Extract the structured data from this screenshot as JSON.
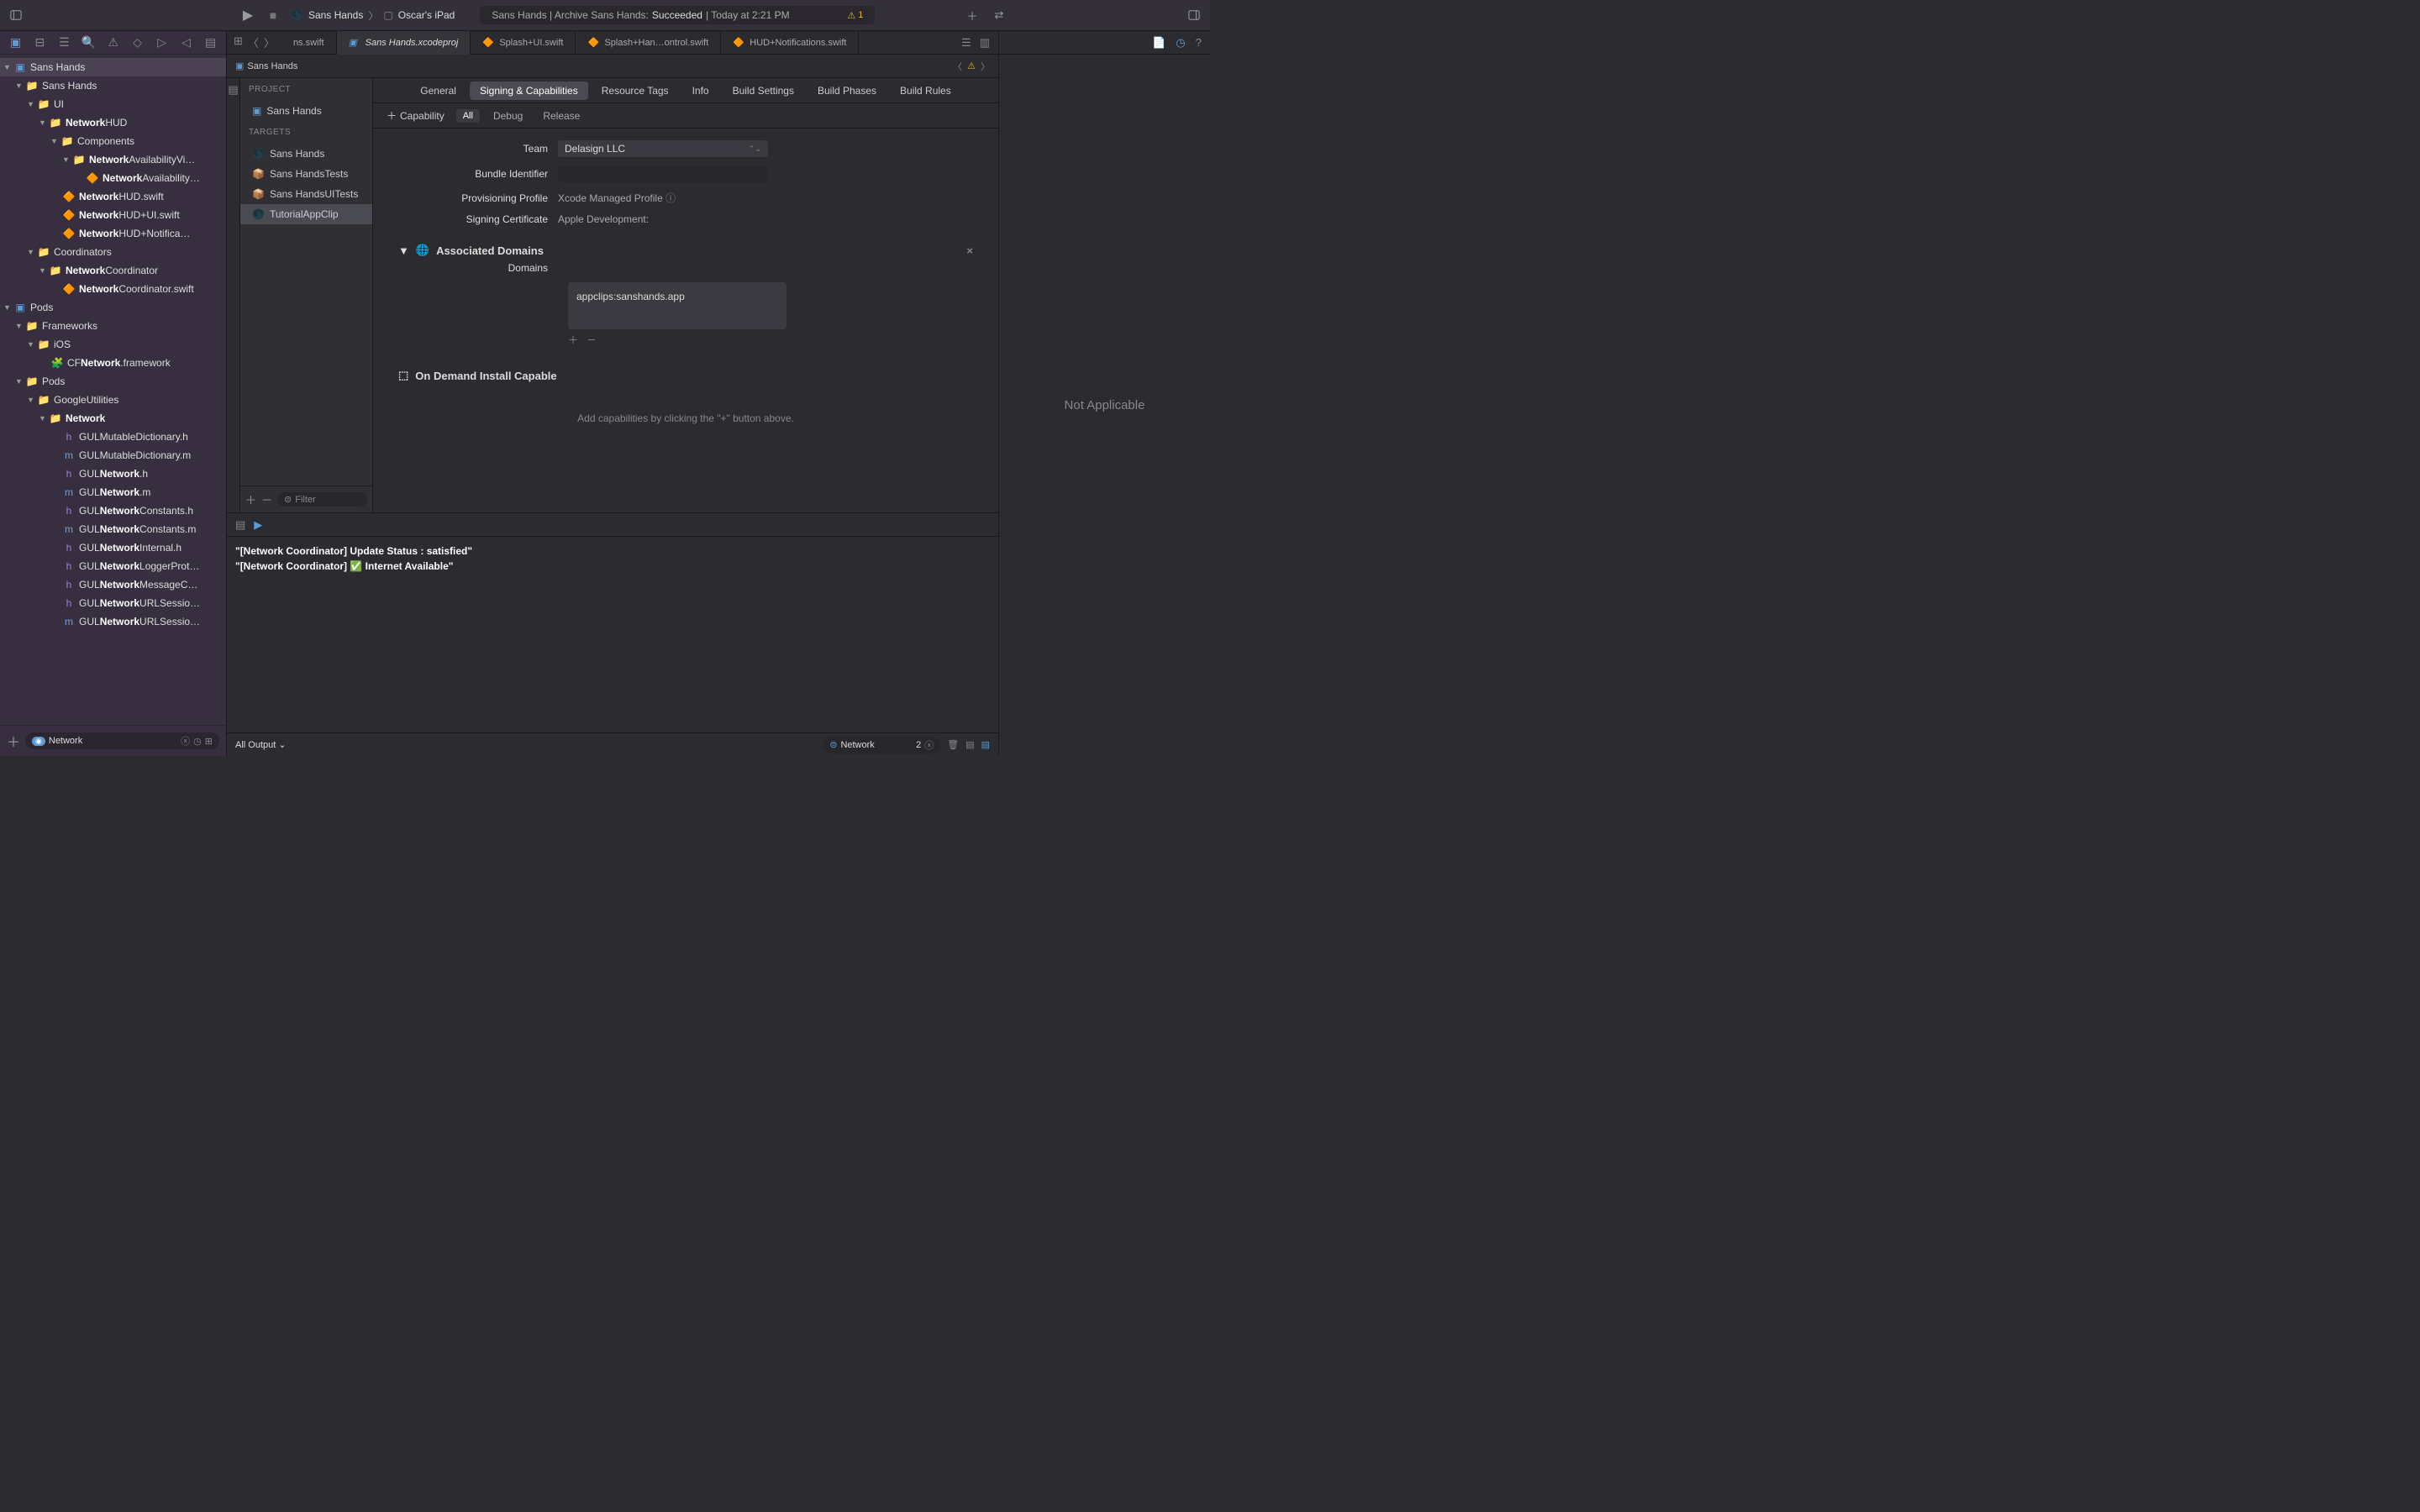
{
  "toolbar": {
    "scheme": "Sans Hands",
    "device": "Oscar's iPad",
    "status_prefix": "Sans Hands | Archive Sans Hands:",
    "status_result": "Succeeded",
    "status_time": "| Today at 2:21 PM",
    "warn_count": "1"
  },
  "navigator": {
    "root": "Sans Hands",
    "tree": {
      "sanshands": "Sans Hands",
      "ui": "UI",
      "networkhud": "NetworkHUD",
      "components": "Components",
      "nav_avail_vi": "NetworkAvailabilityVi…",
      "nav_avail": "NetworkAvailability…",
      "hud_swift": "NetworkHUD.swift",
      "hud_ui": "NetworkHUD+UI.swift",
      "hud_notif": "NetworkHUD+Notifica…",
      "coordinators": "Coordinators",
      "net_coord": "NetworkCoordinator",
      "net_coord_swift": "NetworkCoordinator.swift",
      "pods": "Pods",
      "frameworks": "Frameworks",
      "ios": "iOS",
      "cfnetwork": "CFNetwork.framework",
      "pods2": "Pods",
      "googleutil": "GoogleUtilities",
      "network": "Network",
      "gul_mutdict_h": "GULMutableDictionary.h",
      "gul_mutdict_m": "GULMutableDictionary.m",
      "gul_net_h": "GULNetwork.h",
      "gul_net_m": "GULNetwork.m",
      "gul_const_h": "GULNetworkConstants.h",
      "gul_const_m": "GULNetworkConstants.m",
      "gul_internal": "GULNetworkInternal.h",
      "gul_logger": "GULNetworkLoggerProt…",
      "gul_msgc": "GULNetworkMessageC…",
      "gul_urlsess_h": "GULNetworkURLSessio…",
      "gul_urlsess_m": "GULNetworkURLSessio…"
    },
    "filter": "Network"
  },
  "tabs": [
    {
      "label": "ns.swift",
      "type": "swift"
    },
    {
      "label": "Sans Hands.xcodeproj",
      "type": "proj",
      "active": true
    },
    {
      "label": "Splash+UI.swift",
      "type": "swift"
    },
    {
      "label": "Splash+Han…ontrol.swift",
      "type": "swift"
    },
    {
      "label": "HUD+Notifications.swift",
      "type": "swift"
    }
  ],
  "jumpbar": "Sans Hands",
  "targets": {
    "project_head": "PROJECT",
    "project": "Sans Hands",
    "targets_head": "TARGETS",
    "items": [
      "Sans Hands",
      "Sans HandsTests",
      "Sans HandsUITests",
      "TutorialAppClip"
    ],
    "filter_placeholder": "Filter"
  },
  "project_tabs": [
    "General",
    "Signing & Capabilities",
    "Resource Tags",
    "Info",
    "Build Settings",
    "Build Phases",
    "Build Rules"
  ],
  "cap_bar": {
    "capability": "Capability",
    "all": "All",
    "debug": "Debug",
    "release": "Release"
  },
  "signing": {
    "team_label": "Team",
    "team_value": "Delasign LLC",
    "bundle_label": "Bundle Identifier",
    "bundle_value": "",
    "profile_label": "Provisioning Profile",
    "profile_value": "Xcode Managed Profile",
    "cert_label": "Signing Certificate",
    "cert_value": "Apple Development:"
  },
  "assoc_domains": {
    "title": "Associated Domains",
    "domains_label": "Domains",
    "domain_value": "appclips:sanshands.app"
  },
  "ondemand": "On Demand Install Capable",
  "hint": "Add capabilities by clicking the \"+\" button above.",
  "console": {
    "line1": "\"[Network Coordinator] Update Status : satisfied\"",
    "line2": "\"[Network Coordinator] ✅ Internet Available\""
  },
  "debug_bottom": {
    "output": "All Output",
    "filter": "Network",
    "count": "2"
  },
  "inspector": "Not Applicable"
}
